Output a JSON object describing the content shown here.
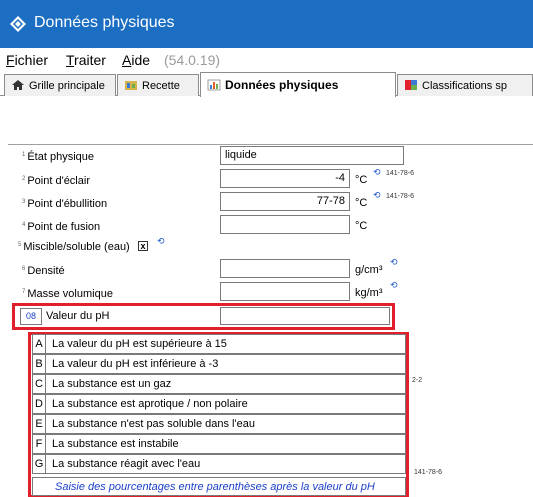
{
  "window": {
    "title": "Données physiques"
  },
  "menu": {
    "fichier": {
      "accel": "F",
      "rest": "ichier"
    },
    "traiter": {
      "accel": "T",
      "rest": "raiter"
    },
    "aide": {
      "accel": "A",
      "rest": "ide"
    },
    "version": "(54.0.19)"
  },
  "tabs": [
    {
      "label": "Grille principale",
      "icon": "home-icon"
    },
    {
      "label": "Recette",
      "icon": "recipe-icon"
    },
    {
      "label": "Données physiques",
      "icon": "data-chart-icon",
      "active": true
    },
    {
      "label": "Classifications sp",
      "icon": "classification-icon"
    }
  ],
  "form": {
    "etat": {
      "num": "1",
      "label": "État physique",
      "value": "liquide"
    },
    "eclair": {
      "num": "2",
      "label": "Point d'éclair",
      "value": "-4",
      "unit": "°C",
      "cas": "141-78-6"
    },
    "ebullition": {
      "num": "3",
      "label": "Point d'ébullition",
      "value": "77-78",
      "unit": "°C",
      "cas": "141-78-6"
    },
    "fusion": {
      "num": "4",
      "label": "Point de fusion",
      "value": "",
      "unit": "°C"
    },
    "miscible": {
      "num": "5",
      "label": "Miscible/soluble (eau)",
      "checked": "x"
    },
    "densite": {
      "num": "6",
      "label": "Densité",
      "value": "",
      "unit": "g/cm³"
    },
    "masse": {
      "num": "7",
      "label": "Masse volumique",
      "value": "",
      "unit": "kg/m³"
    },
    "ph": {
      "num": "08",
      "label": "Valeur du pH",
      "value": ""
    }
  },
  "ph_options": [
    {
      "letter": "A",
      "text": "La valeur du pH est supérieure à 15"
    },
    {
      "letter": "B",
      "text": "La valeur du pH est inférieure à -3"
    },
    {
      "letter": "C",
      "text": "La substance est un gaz"
    },
    {
      "letter": "D",
      "text": "La substance est aprotique / non polaire"
    },
    {
      "letter": "E",
      "text": "La substance n'est pas soluble dans l'eau"
    },
    {
      "letter": "F",
      "text": "La substance est instabile"
    },
    {
      "letter": "G",
      "text": "La substance réagit avec l'eau"
    }
  ],
  "ph_note": "Saisie des pourcentages entre parenthèses après la valeur du pH",
  "background_fragments": {
    "frag1": "2-2",
    "frag2": "141-78-6"
  },
  "colors": {
    "titlebar": "#1c6ec2",
    "highlight": "#e0202a",
    "link": "#1a3fc8"
  }
}
